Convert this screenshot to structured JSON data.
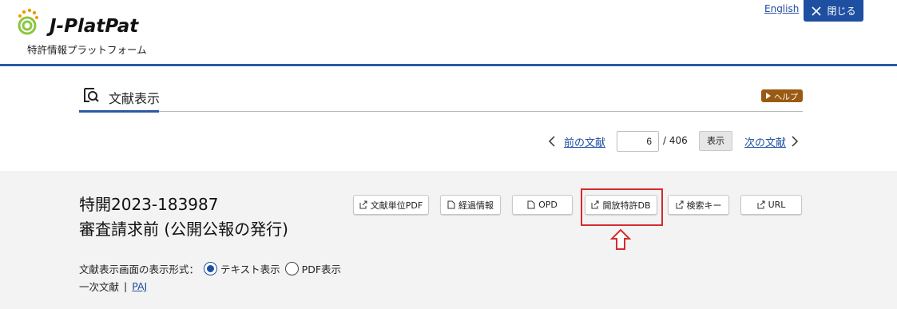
{
  "header": {
    "logo_text": "J-PlatPat",
    "logo_subtitle": "特許情報プラットフォーム",
    "lang_link": "English",
    "close_label": "閉じる"
  },
  "section": {
    "title": "文献表示",
    "help_label": "ヘルプ"
  },
  "pager": {
    "prev_label": "前の文献",
    "current_page": "6",
    "total": "/ 406",
    "show_label": "表示",
    "next_label": "次の文献"
  },
  "document": {
    "number": "特開2023-183987",
    "status": "審査請求前 (公開公報の発行)"
  },
  "actions": [
    {
      "label": "文献単位PDF",
      "icon": "external-link-icon"
    },
    {
      "label": "経過情報",
      "icon": "document-icon"
    },
    {
      "label": "OPD",
      "icon": "document-icon"
    },
    {
      "label": "開放特許DB",
      "icon": "external-link-icon"
    },
    {
      "label": "検索キー",
      "icon": "external-link-icon"
    },
    {
      "label": "URL",
      "icon": "external-link-icon"
    }
  ],
  "display_format": {
    "label": "文献表示画面の表示形式：",
    "options": [
      "テキスト表示",
      "PDF表示"
    ],
    "selected": "テキスト表示"
  },
  "primary_doc": {
    "label": "一次文献",
    "separator": "|",
    "link": "PAJ"
  },
  "colors": {
    "brand_blue": "#1e4fa0",
    "help_brown": "#9a5a12",
    "highlight_red": "#d62b2b"
  }
}
